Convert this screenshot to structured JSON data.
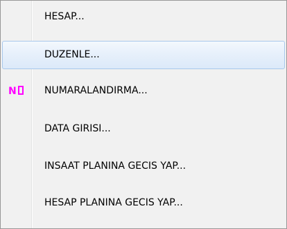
{
  "menu": {
    "items": [
      {
        "label": "HESAP...",
        "icon": "",
        "highlighted": false
      },
      {
        "label": "DUZENLE...",
        "icon": "",
        "highlighted": true
      },
      {
        "label": "NUMARALANDIRMA...",
        "icon": "N",
        "highlighted": false
      },
      {
        "label": "DATA GIRISI...",
        "icon": "",
        "highlighted": false
      },
      {
        "label": "INSAAT PLANINA GECIS YAP...",
        "icon": "",
        "highlighted": false
      },
      {
        "label": "HESAP PLANINA GECIS YAP...",
        "icon": "",
        "highlighted": false
      }
    ],
    "icon_color": "#ff00ff",
    "icon_name": "numbering-icon"
  }
}
